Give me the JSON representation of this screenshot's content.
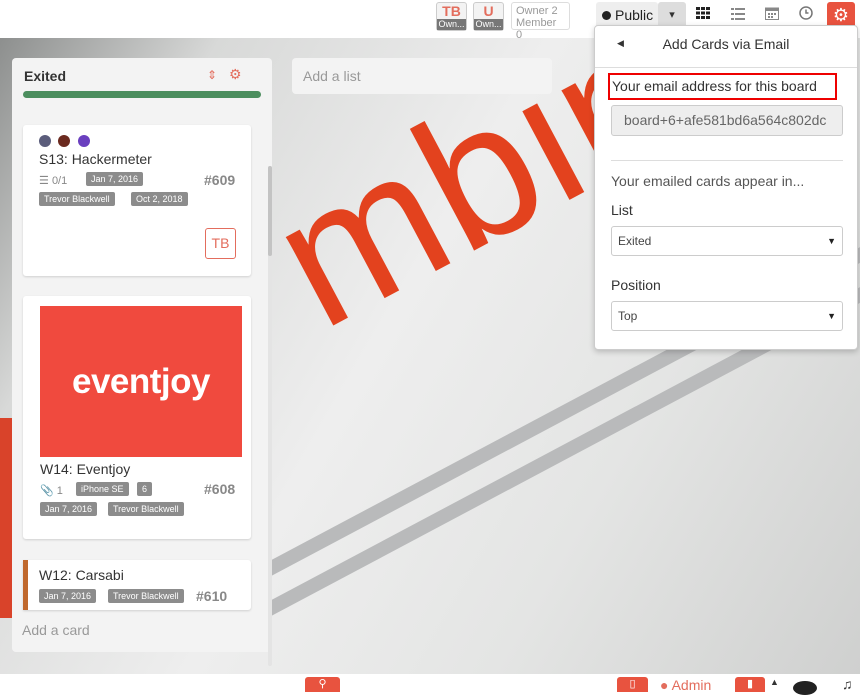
{
  "topbar": {
    "members": [
      {
        "initials": "TB",
        "tag": "Own..."
      },
      {
        "initials": "U",
        "tag": "Own..."
      }
    ],
    "owner_box": {
      "line1": "Owner 2",
      "line2": "Member 0"
    },
    "visibility": "Public",
    "visibility_caret": "▾",
    "icons": [
      "grid-view-icon",
      "list-view-icon",
      "calendar-icon",
      "clock-icon",
      "gear-icon"
    ]
  },
  "list": {
    "title": "Exited",
    "bar_color": "#4c8e5e",
    "cards": [
      {
        "title": "S13: Hackermeter",
        "label_colors": [
          "#5b5d7b",
          "#6b2a1f",
          "#6a3fbf"
        ],
        "checklist": "0/1",
        "date_badge": "Jan 7, 2016",
        "number": "#609",
        "member_badge": "Trevor Blackwell",
        "date_badge2": "Oct 2, 2018",
        "avatar": "TB"
      },
      {
        "title": "W14: Eventjoy",
        "cover_text": "eventjoy",
        "cover_color": "#f04a3e",
        "attachments": "1",
        "badge1": "iPhone SE",
        "badge2": "6",
        "number": "#608",
        "date_badge": "Jan 7, 2016",
        "member_badge": "Trevor Blackwell"
      },
      {
        "title": "W12: Carsabi",
        "accent_color": "#c0692d",
        "date_badge": "Jan 7, 2016",
        "member_badge": "Trevor Blackwell",
        "number": "#610"
      }
    ],
    "add_card": "Add a card"
  },
  "add_list": "Add a list",
  "popup": {
    "title": "Add Cards via Email",
    "email_label": "Your email address for this board",
    "email_value": "board+6+afe581bd6a564c802dc",
    "appear_text": "Your emailed cards appear in...",
    "list_label": "List",
    "list_value": "Exited",
    "position_label": "Position",
    "position_value": "Top"
  },
  "bottom": {
    "admin_label": "Admin"
  }
}
